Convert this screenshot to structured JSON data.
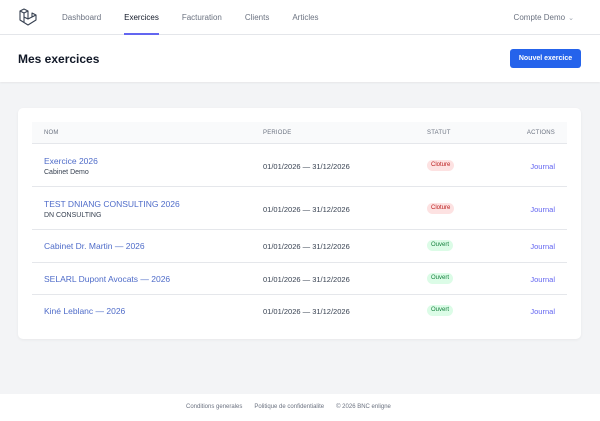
{
  "nav": {
    "items": [
      {
        "label": "Dashboard"
      },
      {
        "label": "Exercices"
      },
      {
        "label": "Facturation"
      },
      {
        "label": "Clients"
      },
      {
        "label": "Articles"
      }
    ],
    "active": "Exercices",
    "account_label": "Compte Demo"
  },
  "header": {
    "title": "Mes exercices",
    "new_button_label": "Nouvel exercice"
  },
  "table": {
    "columns": {
      "name": "NOM",
      "period": "PERIODE",
      "status": "STATUT",
      "actions": "ACTIONS"
    },
    "rows": [
      {
        "name": "Exercice 2026",
        "subtitle": "Cabinet Demo",
        "period": "01/01/2026 — 31/12/2026",
        "status": "Cloture",
        "action": "Journal"
      },
      {
        "name": "TEST DNIANG CONSULTING 2026",
        "subtitle": "DN CONSULTING",
        "period": "01/01/2026 — 31/12/2026",
        "status": "Cloture",
        "action": "Journal"
      },
      {
        "name": "Cabinet Dr. Martin — 2026",
        "subtitle": "",
        "period": "01/01/2026 — 31/12/2026",
        "status": "Ouvert",
        "action": "Journal"
      },
      {
        "name": "SELARL Dupont Avocats — 2026",
        "subtitle": "",
        "period": "01/01/2026 — 31/12/2026",
        "status": "Ouvert",
        "action": "Journal"
      },
      {
        "name": "Kiné Leblanc — 2026",
        "subtitle": "",
        "period": "01/01/2026 — 31/12/2026",
        "status": "Ouvert",
        "action": "Journal"
      }
    ]
  },
  "footer": {
    "terms": "Conditions generales",
    "privacy": "Politique de confidentialite",
    "copyright": "© 2026 BNC enligne"
  },
  "colors": {
    "primary": "#2563eb",
    "accent": "#6366f1",
    "closed_bg": "#fde2e2",
    "closed_text": "#b91c1c",
    "open_bg": "#dcfce7",
    "open_text": "#15803d"
  },
  "icons": {
    "logo": "laravel-logo-icon",
    "account_chevron": "chevron-down-icon"
  }
}
